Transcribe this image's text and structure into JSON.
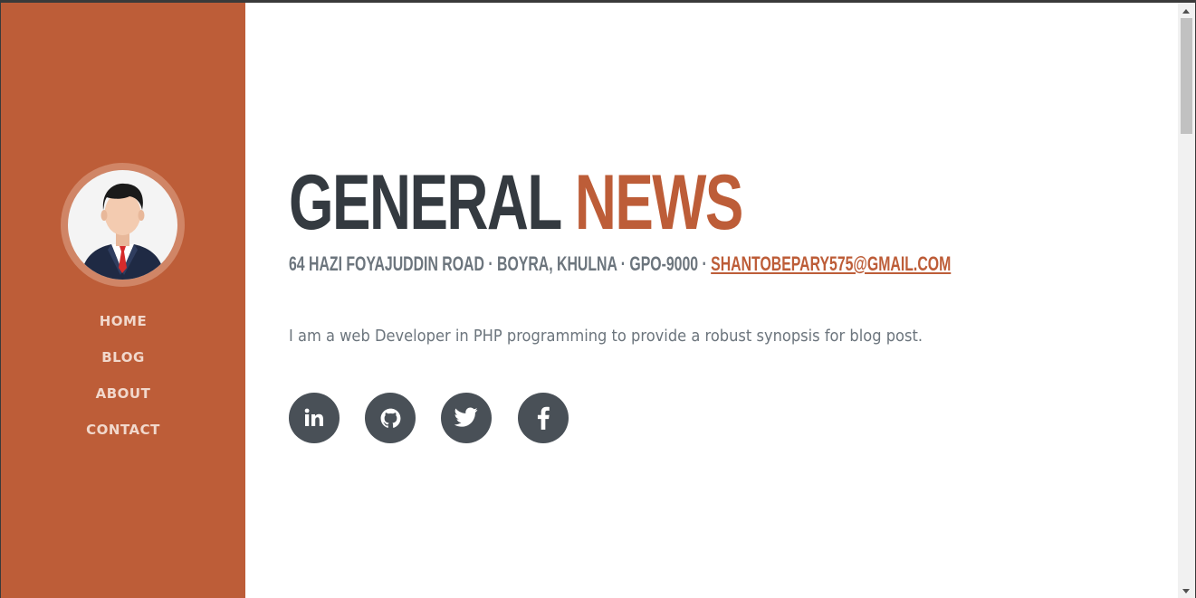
{
  "brand": {
    "accent_color": "#bd5d38",
    "text_dark": "#343a40",
    "text_muted": "#6c757d",
    "social_bg": "#495057"
  },
  "sidebar": {
    "avatar_icon": "businessman-avatar-icon",
    "nav": [
      {
        "label": "HOME"
      },
      {
        "label": "BLOG"
      },
      {
        "label": "ABOUT"
      },
      {
        "label": "CONTACT"
      }
    ]
  },
  "main": {
    "title_first": "GENERAL",
    "title_second": "NEWS",
    "address": "64 HAZI FOYAJUDDIN ROAD · BOYRA, KHULNA · GPO-9000 · ",
    "email": "SHANTOBEPARY575@GMAIL.COM",
    "lead": "I am a web Developer in PHP programming to provide a robust synopsis for blog post.",
    "social": [
      {
        "icon": "linkedin-icon"
      },
      {
        "icon": "github-icon"
      },
      {
        "icon": "twitter-icon"
      },
      {
        "icon": "facebook-icon"
      }
    ]
  }
}
